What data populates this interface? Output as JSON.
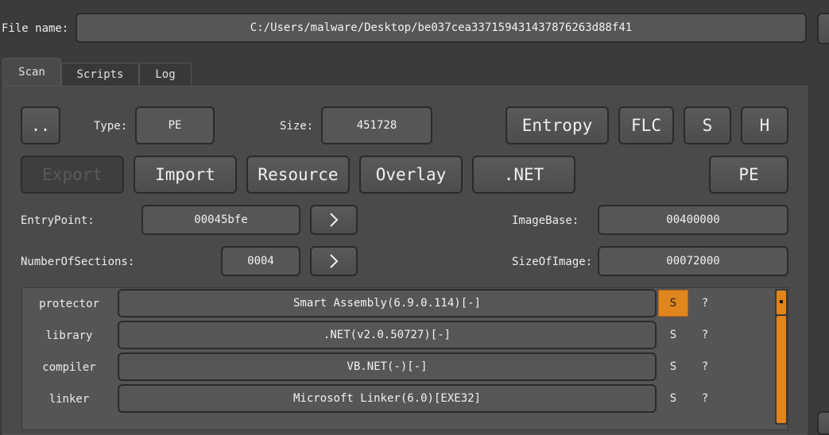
{
  "file": {
    "label": "File name:",
    "path": "C:/Users/malware/Desktop/be037cea337159431437876263d88f41"
  },
  "tabs": [
    {
      "label": "Scan",
      "active": true
    },
    {
      "label": "Scripts",
      "active": false
    },
    {
      "label": "Log",
      "active": false
    }
  ],
  "toolbar": {
    "parent_label": "..",
    "type_label": "Type:",
    "type_value": "PE",
    "size_label": "Size:",
    "size_value": "451728",
    "entropy_label": "Entropy",
    "flc_label": "FLC",
    "s_label": "S",
    "h_label": "H"
  },
  "sections": {
    "export_label": "Export",
    "import_label": "Import",
    "resource_label": "Resource",
    "overlay_label": "Overlay",
    "net_label": ".NET",
    "pe_label": "PE"
  },
  "header_fields": {
    "entrypoint_label": "EntryPoint:",
    "entrypoint_value": "00045bfe",
    "imagebase_label": "ImageBase:",
    "imagebase_value": "00400000",
    "sections_label": "NumberOfSections:",
    "sections_value": "0004",
    "sizeofimage_label": "SizeOfImage:",
    "sizeofimage_value": "00072000",
    "go_icon": "chevron-right-icon"
  },
  "detections": [
    {
      "type": "protector",
      "value": "Smart Assembly(6.9.0.114)[-]",
      "s": "S",
      "q": "?",
      "s_active": true
    },
    {
      "type": "library",
      "value": ".NET(v2.0.50727)[-]",
      "s": "S",
      "q": "?",
      "s_active": false
    },
    {
      "type": "compiler",
      "value": "VB.NET(-)[-]",
      "s": "S",
      "q": "?",
      "s_active": false
    },
    {
      "type": "linker",
      "value": "Microsoft Linker(6.0)[EXE32]",
      "s": "S",
      "q": "?",
      "s_active": false
    }
  ],
  "colors": {
    "background": "#3b3b3b",
    "accent": "#e0861c"
  }
}
